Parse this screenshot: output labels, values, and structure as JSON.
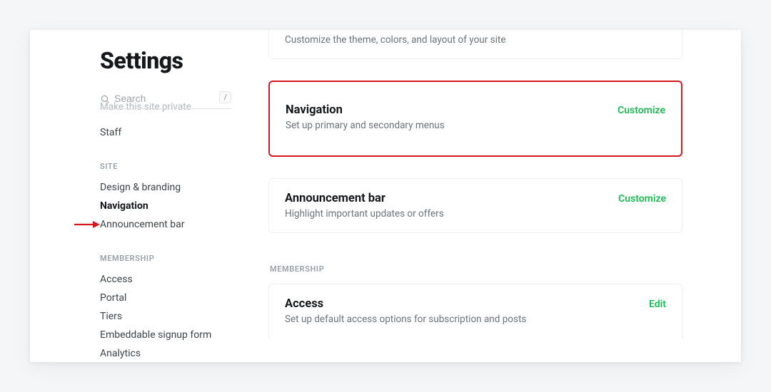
{
  "page": {
    "title": "Settings"
  },
  "search": {
    "placeholder": "Search",
    "shortcut": "/"
  },
  "sidebar": {
    "ghost_item": "Make this site private",
    "top_items": [
      {
        "label": "Staff"
      }
    ],
    "groups": [
      {
        "label": "SITE",
        "items": [
          {
            "label": "Design & branding"
          },
          {
            "label": "Navigation",
            "active": true
          },
          {
            "label": "Announcement bar"
          }
        ]
      },
      {
        "label": "MEMBERSHIP",
        "items": [
          {
            "label": "Access"
          },
          {
            "label": "Portal"
          },
          {
            "label": "Tiers"
          },
          {
            "label": "Embeddable signup form"
          },
          {
            "label": "Analytics"
          }
        ]
      }
    ]
  },
  "main": {
    "cards": [
      {
        "id": "design",
        "title": "",
        "desc": "Customize the theme, colors, and layout of your site",
        "action": ""
      },
      {
        "id": "navigation",
        "title": "Navigation",
        "desc": "Set up primary and secondary menus",
        "action": "Customize",
        "highlight": true
      },
      {
        "id": "announcement",
        "title": "Announcement bar",
        "desc": "Highlight important updates or offers",
        "action": "Customize"
      }
    ],
    "section_label": "MEMBERSHIP",
    "cards2": [
      {
        "id": "access",
        "title": "Access",
        "desc": "Set up default access options for subscription and posts",
        "action": "Edit"
      }
    ]
  },
  "colors": {
    "highlight_border": "#d51820",
    "action_green": "#1db954"
  }
}
